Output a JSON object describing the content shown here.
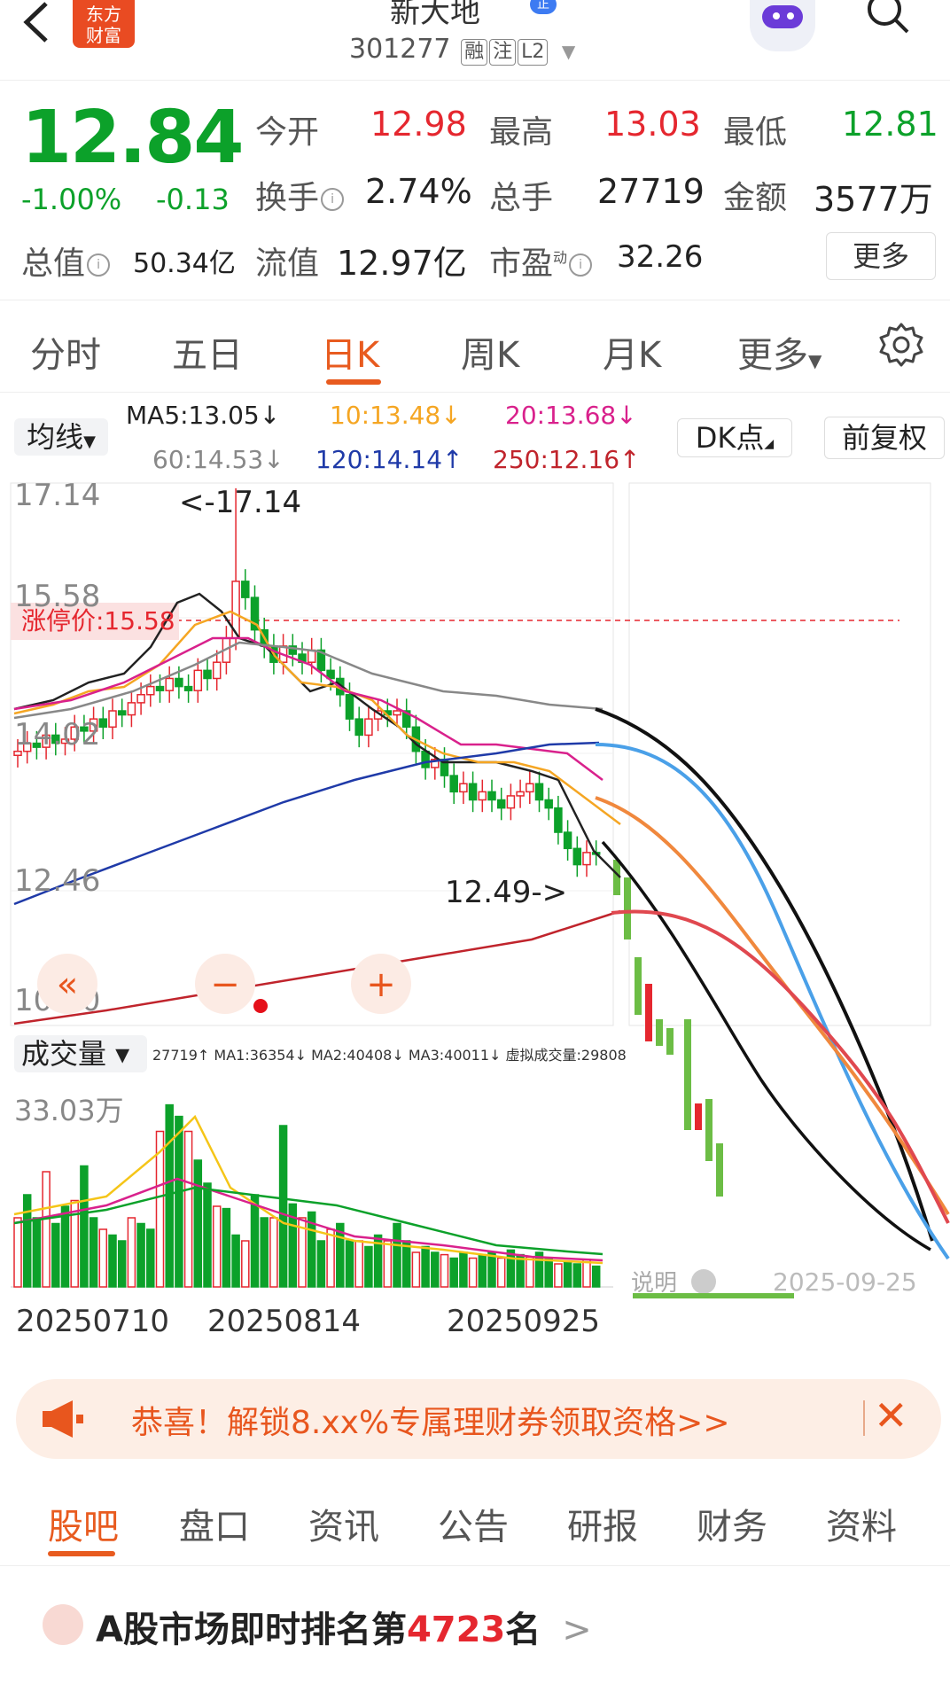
{
  "header": {
    "back_icon": "chevron-left-icon",
    "logo_line1": "东方",
    "logo_line2": "财富",
    "stock_name": "新大地",
    "badge": "正",
    "code": "301277",
    "tags": [
      "融",
      "注",
      "L2"
    ]
  },
  "quote": {
    "price": "12.84",
    "change_pct": "-1.00%",
    "change_abs": "-0.13",
    "open_label": "今开",
    "open_value": "12.98",
    "high_label": "最高",
    "high_value": "13.03",
    "low_label": "最低",
    "low_value": "12.81",
    "turnover_label": "换手",
    "turnover_value": "2.74%",
    "volume_label": "总手",
    "volume_value": "27719",
    "amount_label": "金额",
    "amount_value": "3577万",
    "mktcap_label": "总值",
    "mktcap_value": "50.34亿",
    "float_label": "流值",
    "float_value": "12.97亿",
    "pe_label": "市盈",
    "pe_sup": "动",
    "pe_value": "32.26",
    "more_button": "更多"
  },
  "kline_tabs": [
    "分时",
    "五日",
    "日K",
    "周K",
    "月K",
    "更多"
  ],
  "kline_active": "日K",
  "ma_bar": {
    "select_label": "均线",
    "ma5": "MA5:13.05↓",
    "ma10": "10:13.48↓",
    "ma20": "20:13.68↓",
    "ma60": "60:14.53↓",
    "ma120": "120:14.14↑",
    "ma250": "250:12.16↑",
    "dk_button": "DK点",
    "adjust_button": "前复权"
  },
  "colors": {
    "up": "#e5272f",
    "down": "#0ca12a",
    "accent": "#e85b1f",
    "ma5": "#222222",
    "ma10": "#f5a623",
    "ma20": "#d9218c",
    "ma60": "#888888",
    "ma120": "#1f3aa8",
    "ma250": "#c0242c"
  },
  "chart": {
    "y_ticks": [
      "17.14",
      "15.58",
      "14.02",
      "12.46",
      "10.90"
    ],
    "high_annotation": "<-17.14",
    "low_annotation": "12.49->",
    "limit_up_label": "涨停价:15.58",
    "volume_label": "成交量",
    "volume_legend": "27719↑ MA1:36354↓ MA2:40408↓ MA3:40011↓ 虚拟成交量:29808",
    "volume_max": "33.03万",
    "x_ticks": [
      "20250710",
      "20250814",
      "20250925"
    ],
    "note_label": "说明",
    "date_label": "2025-09-25"
  },
  "banner": {
    "icon": "megaphone-icon",
    "text": "恭喜！解锁8.xx%专属理财券领取资格>>",
    "close_icon": "close-icon"
  },
  "bottom_tabs": [
    "股吧",
    "盘口",
    "资讯",
    "公告",
    "研报",
    "财务",
    "资料"
  ],
  "bottom_active": "股吧",
  "rank": {
    "prefix": "A股市场即时排名第",
    "number": "4723",
    "suffix": "名",
    "arrow": ">"
  }
}
